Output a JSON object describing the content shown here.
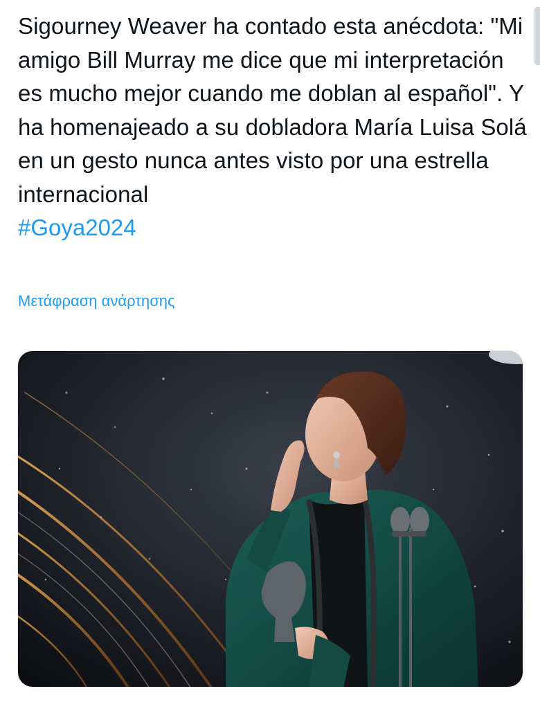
{
  "tweet": {
    "text": "Sigourney Weaver ha contado esta anécdota: \"Mi amigo Bill Murray me dice que mi interpretación es mucho mejor cuando me doblan al español\". Y ha homenajeado a su dobladora María Luisa Solá en un gesto nunca antes visto por una estrella internacional",
    "hashtag": "#Goya2024",
    "translate_label": "Μετάφραση ανάρτησης"
  },
  "colors": {
    "link": "#1d9bf0",
    "text": "#0f1419",
    "dress": "#0f4a45"
  },
  "media": {
    "icon": "photo-image"
  }
}
